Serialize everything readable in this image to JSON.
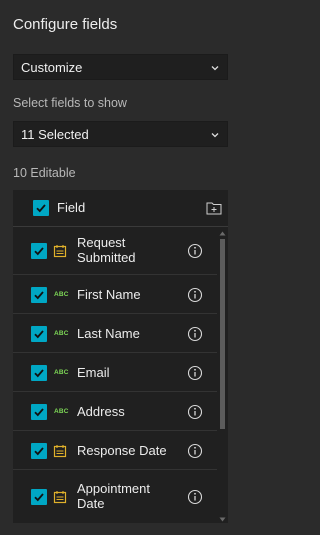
{
  "header": {
    "title": "Configure fields"
  },
  "mode_select": {
    "value": "Customize"
  },
  "fields_select": {
    "label": "Select fields to show",
    "value": "11 Selected"
  },
  "editable_label": "10 Editable",
  "panel": {
    "header_label": "Field"
  },
  "fields": [
    {
      "label": "Request Submitted",
      "type": "date",
      "checked": true
    },
    {
      "label": "First Name",
      "type": "string",
      "checked": true
    },
    {
      "label": "Last Name",
      "type": "string",
      "checked": true
    },
    {
      "label": "Email",
      "type": "string",
      "checked": true
    },
    {
      "label": "Address",
      "type": "string",
      "checked": true
    },
    {
      "label": "Response Date",
      "type": "date",
      "checked": true
    },
    {
      "label": "Appointment Date",
      "type": "date",
      "checked": true
    }
  ],
  "abc_text": "ABC",
  "colors": {
    "accent": "#00a7c4",
    "date_icon": "#e0b12b",
    "string_icon": "#7ed957"
  }
}
